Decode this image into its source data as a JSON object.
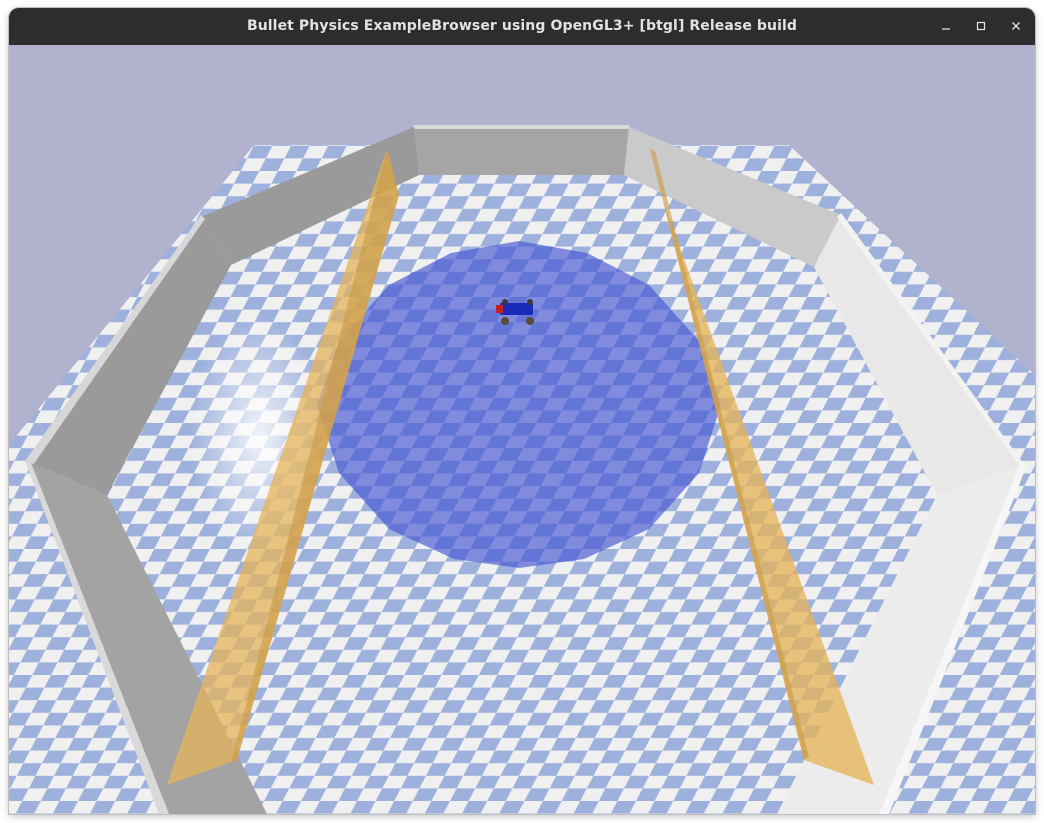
{
  "window": {
    "title": "Bullet Physics ExampleBrowser using OpenGL3+ [btgl] Release build",
    "controls": {
      "minimize_icon": "minimize-icon",
      "maximize_icon": "maximize-icon",
      "close_icon": "close-icon"
    }
  },
  "scene": {
    "sky_color": "#b1b2cd",
    "floor_light_color": "#f1f1f1",
    "floor_blue_color": "#9bb0dc",
    "wall_color": "#c9c9c9",
    "goal_post_color": "#e6b45a",
    "target_zone_color": "#4454d4",
    "vehicle_color": "#1a2ab8"
  }
}
